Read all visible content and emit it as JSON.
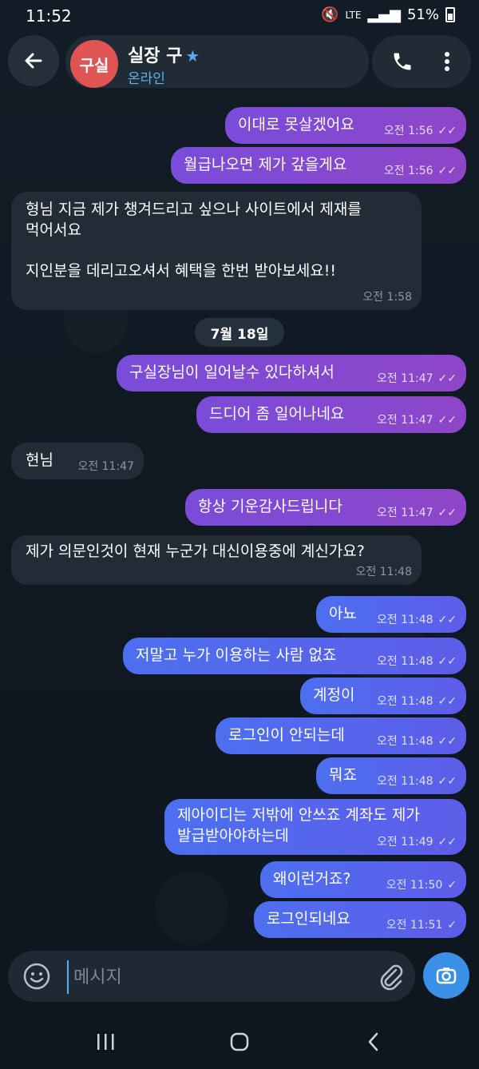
{
  "status": {
    "time": "11:52",
    "network": "LTE",
    "battery": "51%"
  },
  "header": {
    "avatar_initials": "구실",
    "name": "실장 구",
    "status": "온라인"
  },
  "messages": [
    {
      "text": "이대로 못살겠어요",
      "time": "오전 1:56",
      "dir": "out"
    },
    {
      "text": "월급나오면 제가 갚을게요",
      "time": "오전 1:56",
      "dir": "out"
    },
    {
      "text": "형님 지금 제가 챙겨드리고 싶으나 사이트에서 제재를\n먹어서요\n\n지인분을 데리고오셔서 혜택을 한번 받아보세요!!",
      "time": "오전 1:58",
      "dir": "in"
    },
    {
      "text": "구실장님이 일어날수 있다하셔서",
      "time": "오전 11:47",
      "dir": "out"
    },
    {
      "text": "드디어 좀 일어나네요",
      "time": "오전 11:47",
      "dir": "out"
    },
    {
      "text": "현님",
      "time": "오전 11:47",
      "dir": "in"
    },
    {
      "text": "항상 기운감사드립니다",
      "time": "오전 11:47",
      "dir": "out"
    },
    {
      "text": "제가 의문인것이 현재 누군가 대신이용중에 계신가요?",
      "time": "오전 11:48",
      "dir": "in"
    },
    {
      "text": "아뇨",
      "time": "오전 11:48",
      "dir": "out"
    },
    {
      "text": "저말고 누가 이용하는 사람 없죠",
      "time": "오전 11:48",
      "dir": "out"
    },
    {
      "text": "계정이",
      "time": "오전 11:48",
      "dir": "out"
    },
    {
      "text": "로그인이 안되는데",
      "time": "오전 11:48",
      "dir": "out"
    },
    {
      "text": "뭐죠",
      "time": "오전 11:48",
      "dir": "out"
    },
    {
      "text": "제아이디는 저밖에 안쓰죠 계좌도 제가\n발급받아야하는데",
      "time": "오전 11:49",
      "dir": "out"
    },
    {
      "text": "왜이런거죠?",
      "time": "오전 11:50",
      "dir": "out"
    },
    {
      "text": "로그인되네요",
      "time": "오전 11:51",
      "dir": "out"
    }
  ],
  "date_separator": "7월 18일",
  "composer": {
    "placeholder": "메시지"
  },
  "icons": {
    "back": "arrow-left-icon",
    "call": "phone-icon",
    "menu": "more-vertical-icon",
    "emoji": "smile-icon",
    "attach": "paperclip-icon",
    "camera": "camera-icon"
  },
  "colors": {
    "outgoing_purple": "#7a4cd9",
    "outgoing_blue": "#4d6ff0",
    "incoming": "#222c37",
    "accent": "#3a8fe6"
  }
}
